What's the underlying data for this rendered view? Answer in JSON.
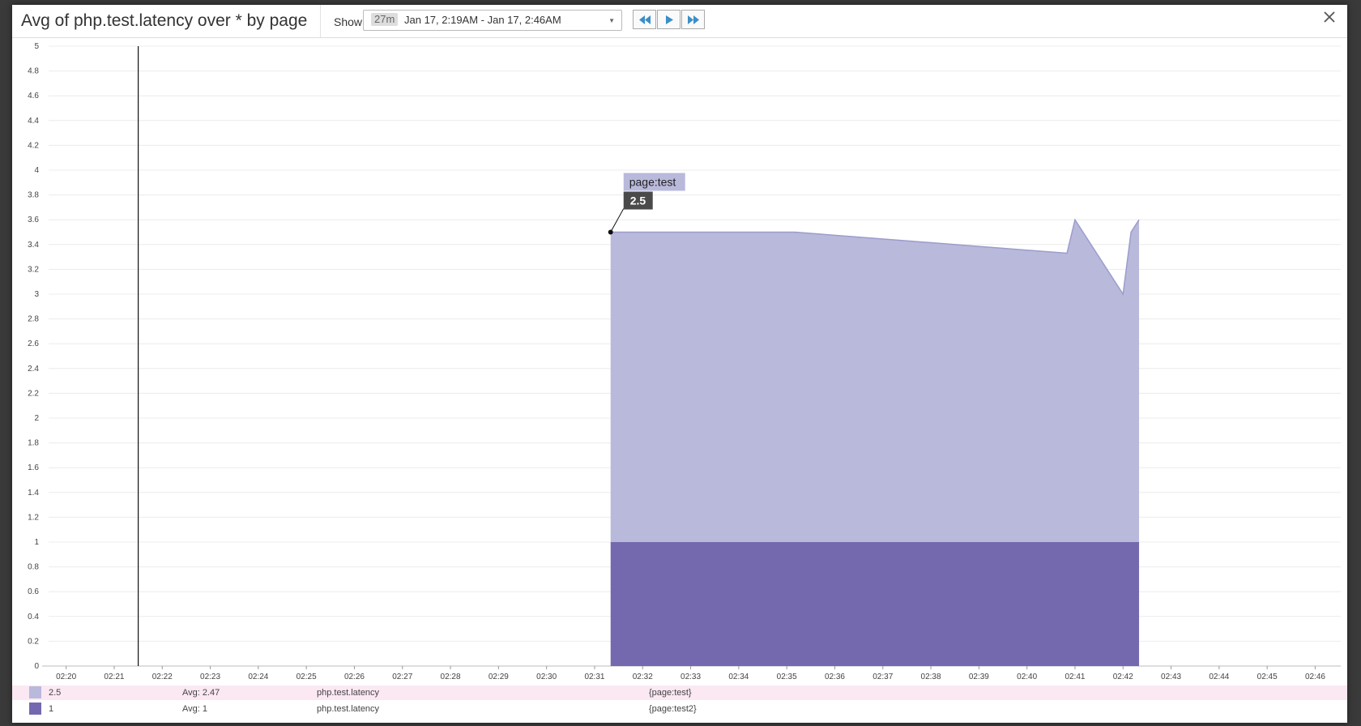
{
  "modal": {
    "title": "Avg of php.test.latency over * by page",
    "show_label": "Show",
    "range_badge": "27m",
    "range_text": "Jan 17, 2:19AM - Jan 17, 2:46AM"
  },
  "colors": {
    "series_1": "#b9b9dc",
    "series_1_line": "#9c9ccc",
    "series_2": "#7469ae",
    "legend_highlight": "#fbe8f3",
    "tooltip_label_bg": "#b9b9dc",
    "tooltip_value_bg": "#4a4a4a"
  },
  "tooltip": {
    "label": "page:test",
    "value": "2.5",
    "x": "02:31:20",
    "y": 3.5
  },
  "legend": [
    {
      "value": "2.5",
      "avg": "Avg: 2.47",
      "metric": "php.test.latency",
      "tags": "{page:test}",
      "highlighted": true
    },
    {
      "value": "1",
      "avg": "Avg: 1",
      "metric": "php.test.latency",
      "tags": "{page:test2}",
      "highlighted": false
    }
  ],
  "chart_data": {
    "type": "area",
    "stacked": true,
    "xlim": [
      "02:19:30",
      "02:46:40"
    ],
    "ylim": [
      0,
      5
    ],
    "x_ticks": [
      "02:20",
      "02:21",
      "02:22",
      "02:23",
      "02:24",
      "02:25",
      "02:26",
      "02:27",
      "02:28",
      "02:29",
      "02:30",
      "02:31",
      "02:32",
      "02:33",
      "02:34",
      "02:35",
      "02:36",
      "02:37",
      "02:38",
      "02:39",
      "02:40",
      "02:41",
      "02:42",
      "02:43",
      "02:44",
      "02:45",
      "02:46"
    ],
    "y_ticks": [
      "0",
      "0.2",
      "0.4",
      "0.6",
      "0.8",
      "1",
      "1.2",
      "1.4",
      "1.6",
      "1.8",
      "2",
      "2.2",
      "2.4",
      "2.6",
      "2.8",
      "3",
      "3.2",
      "3.4",
      "3.6",
      "3.8",
      "4",
      "4.2",
      "4.4",
      "4.6",
      "4.8",
      "5"
    ],
    "grid": true,
    "cursor_x": "02:21:30",
    "series": [
      {
        "tag": "page:test",
        "x": [
          "02:31:20",
          "02:35:10",
          "02:40:50",
          "02:41:00",
          "02:42:00",
          "02:42:10",
          "02:42:20"
        ],
        "values": [
          2.5,
          2.5,
          2.33,
          2.6,
          2.0,
          2.5,
          2.6
        ]
      },
      {
        "tag": "page:test2",
        "x": [
          "02:31:20",
          "02:42:20"
        ],
        "values": [
          1,
          1
        ]
      }
    ]
  }
}
